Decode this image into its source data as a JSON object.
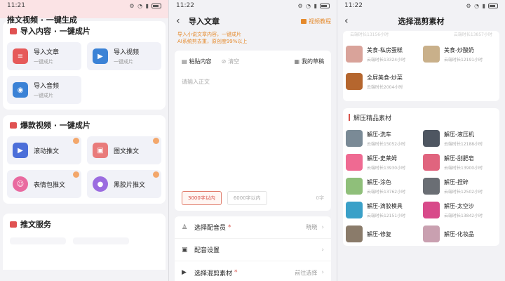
{
  "screen1": {
    "status_time": "11:21",
    "app_title": "推文视频 · 一键生成",
    "section_import": {
      "title": "导入内容 · 一键成片",
      "color": "#e05252",
      "tiles": [
        {
          "label": "导入文章",
          "sub": "一键成片",
          "icon": "document-icon",
          "color": "#e65a5a"
        },
        {
          "label": "导入视频",
          "sub": "一键成片",
          "icon": "video-icon",
          "color": "#3b82d6"
        },
        {
          "label": "导入音频",
          "sub": "一键成片",
          "icon": "audio-icon",
          "color": "#3b82d6"
        }
      ]
    },
    "section_hot": {
      "title": "爆款视频 · 一键成片",
      "color": "#e05252",
      "tiles": [
        {
          "label": "滚动推文",
          "icon": "scroll-icon",
          "color": "#4c6fd9"
        },
        {
          "label": "图文推文",
          "icon": "image-icon",
          "color": "#e97b7b"
        },
        {
          "label": "表情包推文",
          "icon": "emoji-icon",
          "color": "#e96aa0"
        },
        {
          "label": "黑胶片推文",
          "icon": "vinyl-icon",
          "color": "#9b6ce0"
        }
      ]
    },
    "section_service": {
      "title": "推文服务",
      "color": "#e05252"
    }
  },
  "screen2": {
    "status_time": "11:22",
    "title": "导入文章",
    "tutorial_label": "视频教程",
    "tip_line1": "导入小说文章内容，一键成片",
    "tip_line2": "AI系统剪去重，原创度99%以上",
    "toolbar": {
      "paste": "粘贴内容",
      "clear": "清空",
      "drafts": "我的草稿"
    },
    "placeholder": "请输入正文",
    "chips": [
      "3000字以内",
      "6000字以内"
    ],
    "char_count": "0字",
    "rows": [
      {
        "label": "选择配音员",
        "required": true,
        "value": "晓晓"
      },
      {
        "label": "配音设置",
        "required": false,
        "value": ""
      },
      {
        "label": "选择混剪素材",
        "required": true,
        "value": "前往选择"
      }
    ]
  },
  "screen3": {
    "status_time": "11:22",
    "title": "选择混剪素材",
    "top_cut_left": "云端时长13156小时",
    "top_cut_right": "云端时长13857小时",
    "food_items": [
      {
        "name": "美食-私房蛋糕",
        "duration": "云端时长13324小时",
        "color": "#d9a39a"
      },
      {
        "name": "美食-炒酸奶",
        "duration": "云端时长12191小时",
        "color": "#c9b08a"
      },
      {
        "name": "全屏美食-炒菜",
        "duration": "云端时长2004小时",
        "color": "#b5662e"
      }
    ],
    "category2_title": "解压精品素材",
    "decompress_items": [
      {
        "name": "解压-洗车",
        "duration": "云端时长15052小时",
        "color": "#7a8a96"
      },
      {
        "name": "解压-液压机",
        "duration": "云端时长12188小时",
        "color": "#4e5661"
      },
      {
        "name": "解压-史莱姆",
        "duration": "云端时长13930小时",
        "color": "#ef6a92"
      },
      {
        "name": "解压-刮肥皂",
        "duration": "云端时长13900小时",
        "color": "#e0647e"
      },
      {
        "name": "解压-涂色",
        "duration": "云端时长13762小时",
        "color": "#8fbf7a"
      },
      {
        "name": "解压-捏碎",
        "duration": "云端时长12502小时",
        "color": "#6a6e74"
      },
      {
        "name": "解压-滴胶模具",
        "duration": "云端时长12151小时",
        "color": "#3aa0c8"
      },
      {
        "name": "解压-太空沙",
        "duration": "云端时长13842小时",
        "color": "#d84a8a"
      },
      {
        "name": "解压-修复",
        "duration": "",
        "color": "#8a7b6a"
      },
      {
        "name": "解压-化妆品",
        "duration": "",
        "color": "#c9a0b0"
      }
    ]
  }
}
